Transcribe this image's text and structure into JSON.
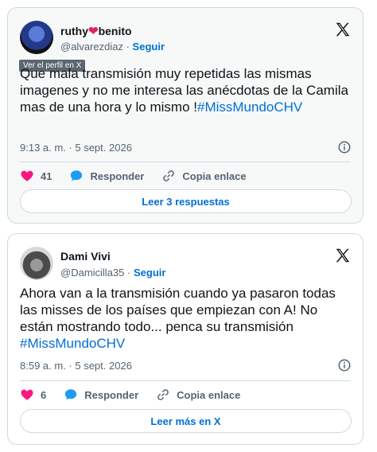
{
  "tweets": [
    {
      "name_part1": "ruthy",
      "name_heart": "❤",
      "name_part2": "benito",
      "handle": "@alvarezdiaz",
      "sep": "·",
      "follow": "Seguir",
      "tooltip": "Ver el perfil en X",
      "text": "Que mala transmisión muy repetidas las mismas imagenes y no me interesa las anécdotas de la Camila  mas de una hora y lo mismo !",
      "hashtag": "#MissMundoCHV",
      "time": "9:13 a. m. · 5 sept. 2026",
      "likes": "41",
      "reply_label": "Responder",
      "copy_label": "Copia enlace",
      "cta": "Leer 3 respuestas",
      "icons": [
        "avatar",
        "x-logo-icon",
        "info-icon",
        "heart-icon",
        "reply-bubble-icon",
        "link-icon"
      ]
    },
    {
      "name": "Dami Vivi",
      "handle": "@Damicilla35",
      "sep": "·",
      "follow": "Seguir",
      "text": "Ahora van a la transmisión cuando ya pasaron todas las misses de los países que empiezan con A! No están mostrando todo... penca su transmisión ",
      "hashtag": "#MissMundoCHV",
      "time": "8:59 a. m. · 5 sept. 2026",
      "likes": "6",
      "reply_label": "Responder",
      "copy_label": "Copia enlace",
      "cta": "Leer más en X",
      "icons": [
        "avatar",
        "x-logo-icon",
        "info-icon",
        "heart-icon",
        "reply-bubble-icon",
        "link-icon"
      ]
    }
  ],
  "colors": {
    "accent": "#006fd6",
    "heart": "#f91880",
    "muted": "#536471",
    "border": "#cfd9de"
  }
}
